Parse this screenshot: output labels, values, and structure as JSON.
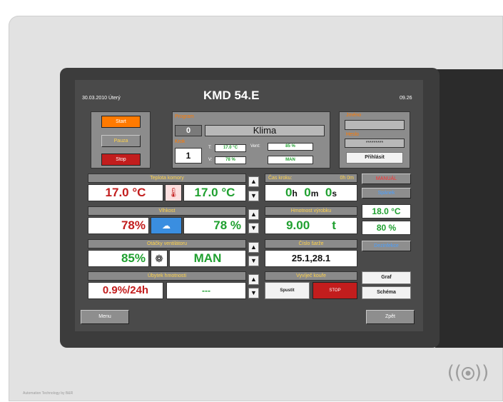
{
  "header": {
    "date": "30.03.2010  Úterý",
    "title": "KMD 54.E",
    "time": "09.26"
  },
  "controls": {
    "start": "Start",
    "pause": "Pauza",
    "stop": "Stop"
  },
  "program": {
    "program_label": "Program",
    "program_number": "0",
    "program_name": "Klima",
    "step_label": "Krok",
    "step_number": "1",
    "t_label": "T:",
    "t_value": "17.0 °C",
    "v_label": "V:",
    "v_value": "78  %",
    "vent_label": "Vent:",
    "vent_value": "85       %",
    "vent_mode": "MAN"
  },
  "login": {
    "name_label": "Jméno",
    "name_value": "",
    "password_label": "Heslo",
    "password_value": "*********",
    "login_button": "Přihlásit"
  },
  "sections": {
    "temp": {
      "label": "Teplota komory",
      "value1": "17.0 °C",
      "value2": "17.0 °C"
    },
    "humidity": {
      "label": "Vlhkost",
      "value1": "78%",
      "value2": "78 %"
    },
    "fan": {
      "label": "Otáčky ventilátoru",
      "value1": "85%",
      "value2": "MAN"
    },
    "weight_loss": {
      "label": "Úbytek hmotnosti",
      "value1": "0.9%/24h",
      "value2": "---"
    },
    "step_time": {
      "label": "Čas kroku:",
      "time_small": "0h  0m",
      "hours": "0",
      "hours_unit": "h",
      "minutes": "0",
      "minutes_unit": "m",
      "seconds": "0",
      "seconds_unit": "s"
    },
    "product_weight": {
      "label": "Hmotnost výrobku",
      "value": "9.00",
      "unit": "t"
    },
    "batch": {
      "label": "Číslo šarže",
      "value": "25.1,28.1"
    },
    "smoke": {
      "label": "Vyvíječ kouře",
      "start": "Spustit",
      "stop": "STOP"
    }
  },
  "right": {
    "manual": "MANUÁL",
    "sleep": "Spánek",
    "temp": "18.0 °C",
    "humidity": "80 %",
    "disinfection": "Dezinfekce",
    "graph": "Graf",
    "scheme": "Schéma"
  },
  "footer": {
    "menu": "Menu",
    "back": "Zpět"
  },
  "branding": {
    "company": "Automation Technology by B&R"
  },
  "colors": {
    "orange": "#ff7a00",
    "red": "#c21d1d",
    "green": "#20a030",
    "yellow": "#ffd24a"
  }
}
